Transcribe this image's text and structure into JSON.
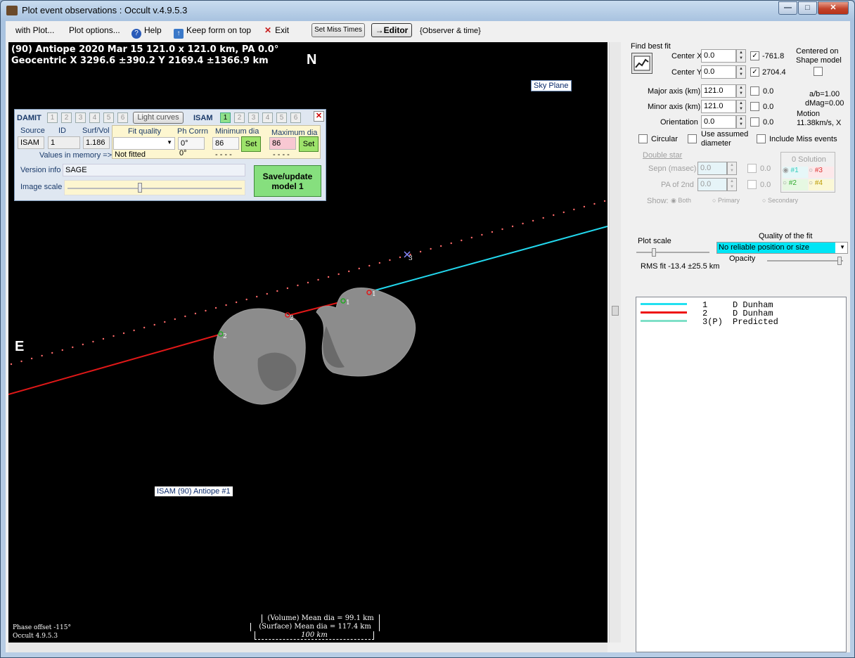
{
  "window": {
    "title": "Plot event observations : Occult v.4.9.5.3",
    "controls": {
      "minimize": "—",
      "maximize": "□",
      "close": "✕"
    }
  },
  "menu": {
    "with_plot": "with Plot...",
    "plot_options": "Plot options...",
    "help": "Help",
    "keep_on_top": "Keep form on top",
    "exit": "Exit",
    "set_miss_times": "Set Miss Times",
    "editor": "→Editor",
    "observer_time": "{Observer & time}"
  },
  "plot": {
    "header_line1": "(90) Antiope  2020 Mar 15   121.0 x 121.0 km, PA 0.0°",
    "header_line2": "Geocentric  X  3296.6 ±390.2  Y 2169.4 ±1366.9 km",
    "north": "N",
    "east": "E",
    "sky_plane": "Sky Plane",
    "model_label": "ISAM (90) Antiope  #1",
    "chord_labels": [
      "1",
      "1",
      "2",
      "2",
      "3"
    ],
    "phase_offset": "Phase offset -115°",
    "version": "Occult 4.9.5.3",
    "scale_volume": "(Volume) Mean dia = 99.1 km",
    "scale_surface": "(Surface) Mean dia = 117.4 km",
    "scale_bar": "100 km"
  },
  "editor": {
    "damit": "DAMIT",
    "isam": "ISAM",
    "light_curves": "Light curves",
    "damit_nums": [
      "1",
      "2",
      "3",
      "4",
      "5",
      "6"
    ],
    "isam_nums": [
      "1",
      "2",
      "3",
      "4",
      "5",
      "6"
    ],
    "isam_active": "1",
    "col_source": "Source",
    "col_id": "ID",
    "col_surf_vol": "Surf/Vol",
    "col_fit_quality": "Fit quality",
    "col_ph_corrn": "Ph Corrn",
    "col_min_dia": "Minimum dia",
    "col_max_dia": "Maximum dia",
    "source": "ISAM",
    "id": "1",
    "surf_vol": "1.186",
    "ph_corrn": "0°",
    "min_dia": "86",
    "max_dia": "86",
    "set": "Set",
    "values_in_memory": "Values in memory =>",
    "not_fitted": "Not fitted",
    "mem_ph": "0°",
    "mem_min": "- - - -",
    "mem_max": "- - - -",
    "version_info_label": "Version info",
    "version_info": "SAGE",
    "image_scale": "Image scale",
    "save_update": "Save/update",
    "save_model": "model  1",
    "close": "✕"
  },
  "side": {
    "find_best_fit": "Find best fit",
    "center_x_label": "Center X",
    "center_x": "0.0",
    "center_x_fit": "-761.8",
    "center_y_label": "Center Y",
    "center_y": "0.0",
    "center_y_fit": "2704.4",
    "centered_on": "Centered on",
    "shape_model": "Shape model",
    "major_label": "Major axis (km)",
    "major": "121.0",
    "major_fit": "0.0",
    "minor_label": "Minor axis (km)",
    "minor": "121.0",
    "minor_fit": "0.0",
    "orient_label": "Orientation",
    "orient": "0.0",
    "orient_fit": "0.0",
    "ab": "a/b=1.00",
    "dmag": "dMag=0.00",
    "motion_label": "Motion",
    "motion": "11.38km/s, X",
    "circular": "Circular",
    "use_assumed": "Use assumed",
    "diameter": "diameter",
    "include_miss": "Include Miss events",
    "double_star": "Double star",
    "sepn_label": "Sepn (masec)",
    "sepn": "0.0",
    "sepn_fit": "0.0",
    "pa2_label": "PA of 2nd",
    "pa2": "0.0",
    "pa2_fit": "0.0",
    "show": "Show:",
    "both": "Both",
    "primary": "Primary",
    "secondary": "Secondary",
    "solution_title": "0 Solution",
    "sol1": "#1",
    "sol2": "#2",
    "sol3": "#3",
    "sol4": "#4",
    "plot_scale": "Plot scale",
    "quality_label": "Quality of the fit",
    "quality_value": "No reliable position or size",
    "opacity": "Opacity",
    "rms": "RMS fit -13.4 ±25.5 km"
  },
  "legend": [
    {
      "num": "1",
      "observer": "D Dunham",
      "color": "#22e0f0"
    },
    {
      "num": "2",
      "observer": "D Dunham",
      "color": "#ee1111"
    },
    {
      "num": "3(P)",
      "observer": "Predicted",
      "color": "#7fe0c8"
    }
  ],
  "colors": {
    "chord1": "#22d8ee",
    "chord2": "#e01818",
    "predicted": "#ff6a6a",
    "asteroid": "#8a8a8a"
  }
}
